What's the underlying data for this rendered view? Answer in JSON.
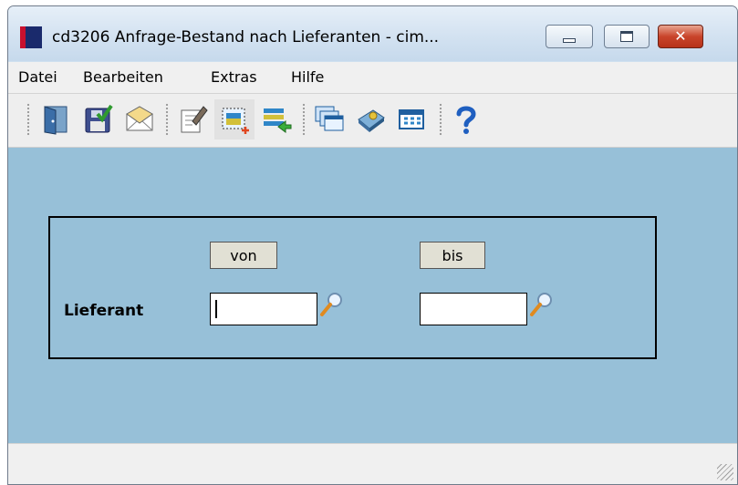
{
  "window": {
    "title": "cd3206 Anfrage-Bestand nach Lieferanten - cim...",
    "controls": {
      "minimize": "minimize",
      "maximize": "maximize",
      "close": "✕"
    }
  },
  "menu": {
    "items": [
      "Datei",
      "Bearbeiten",
      "Extras",
      "Hilfe"
    ]
  },
  "toolbar": {
    "icons": [
      "exit-door-icon",
      "save-icon",
      "mail-icon",
      "edit-note-icon",
      "new-record-icon",
      "transfer-list-icon",
      "windows-icon",
      "book-icon",
      "table-icon",
      "help-icon"
    ]
  },
  "form": {
    "col_from": "von",
    "col_to": "bis",
    "row_label": "Lieferant",
    "supplier_from": "",
    "supplier_to": ""
  },
  "status": {
    "text": ""
  },
  "colors": {
    "content_bg": "#97c0d8",
    "label_bg": "#e1e0d4",
    "close_red": "#c9452b"
  }
}
